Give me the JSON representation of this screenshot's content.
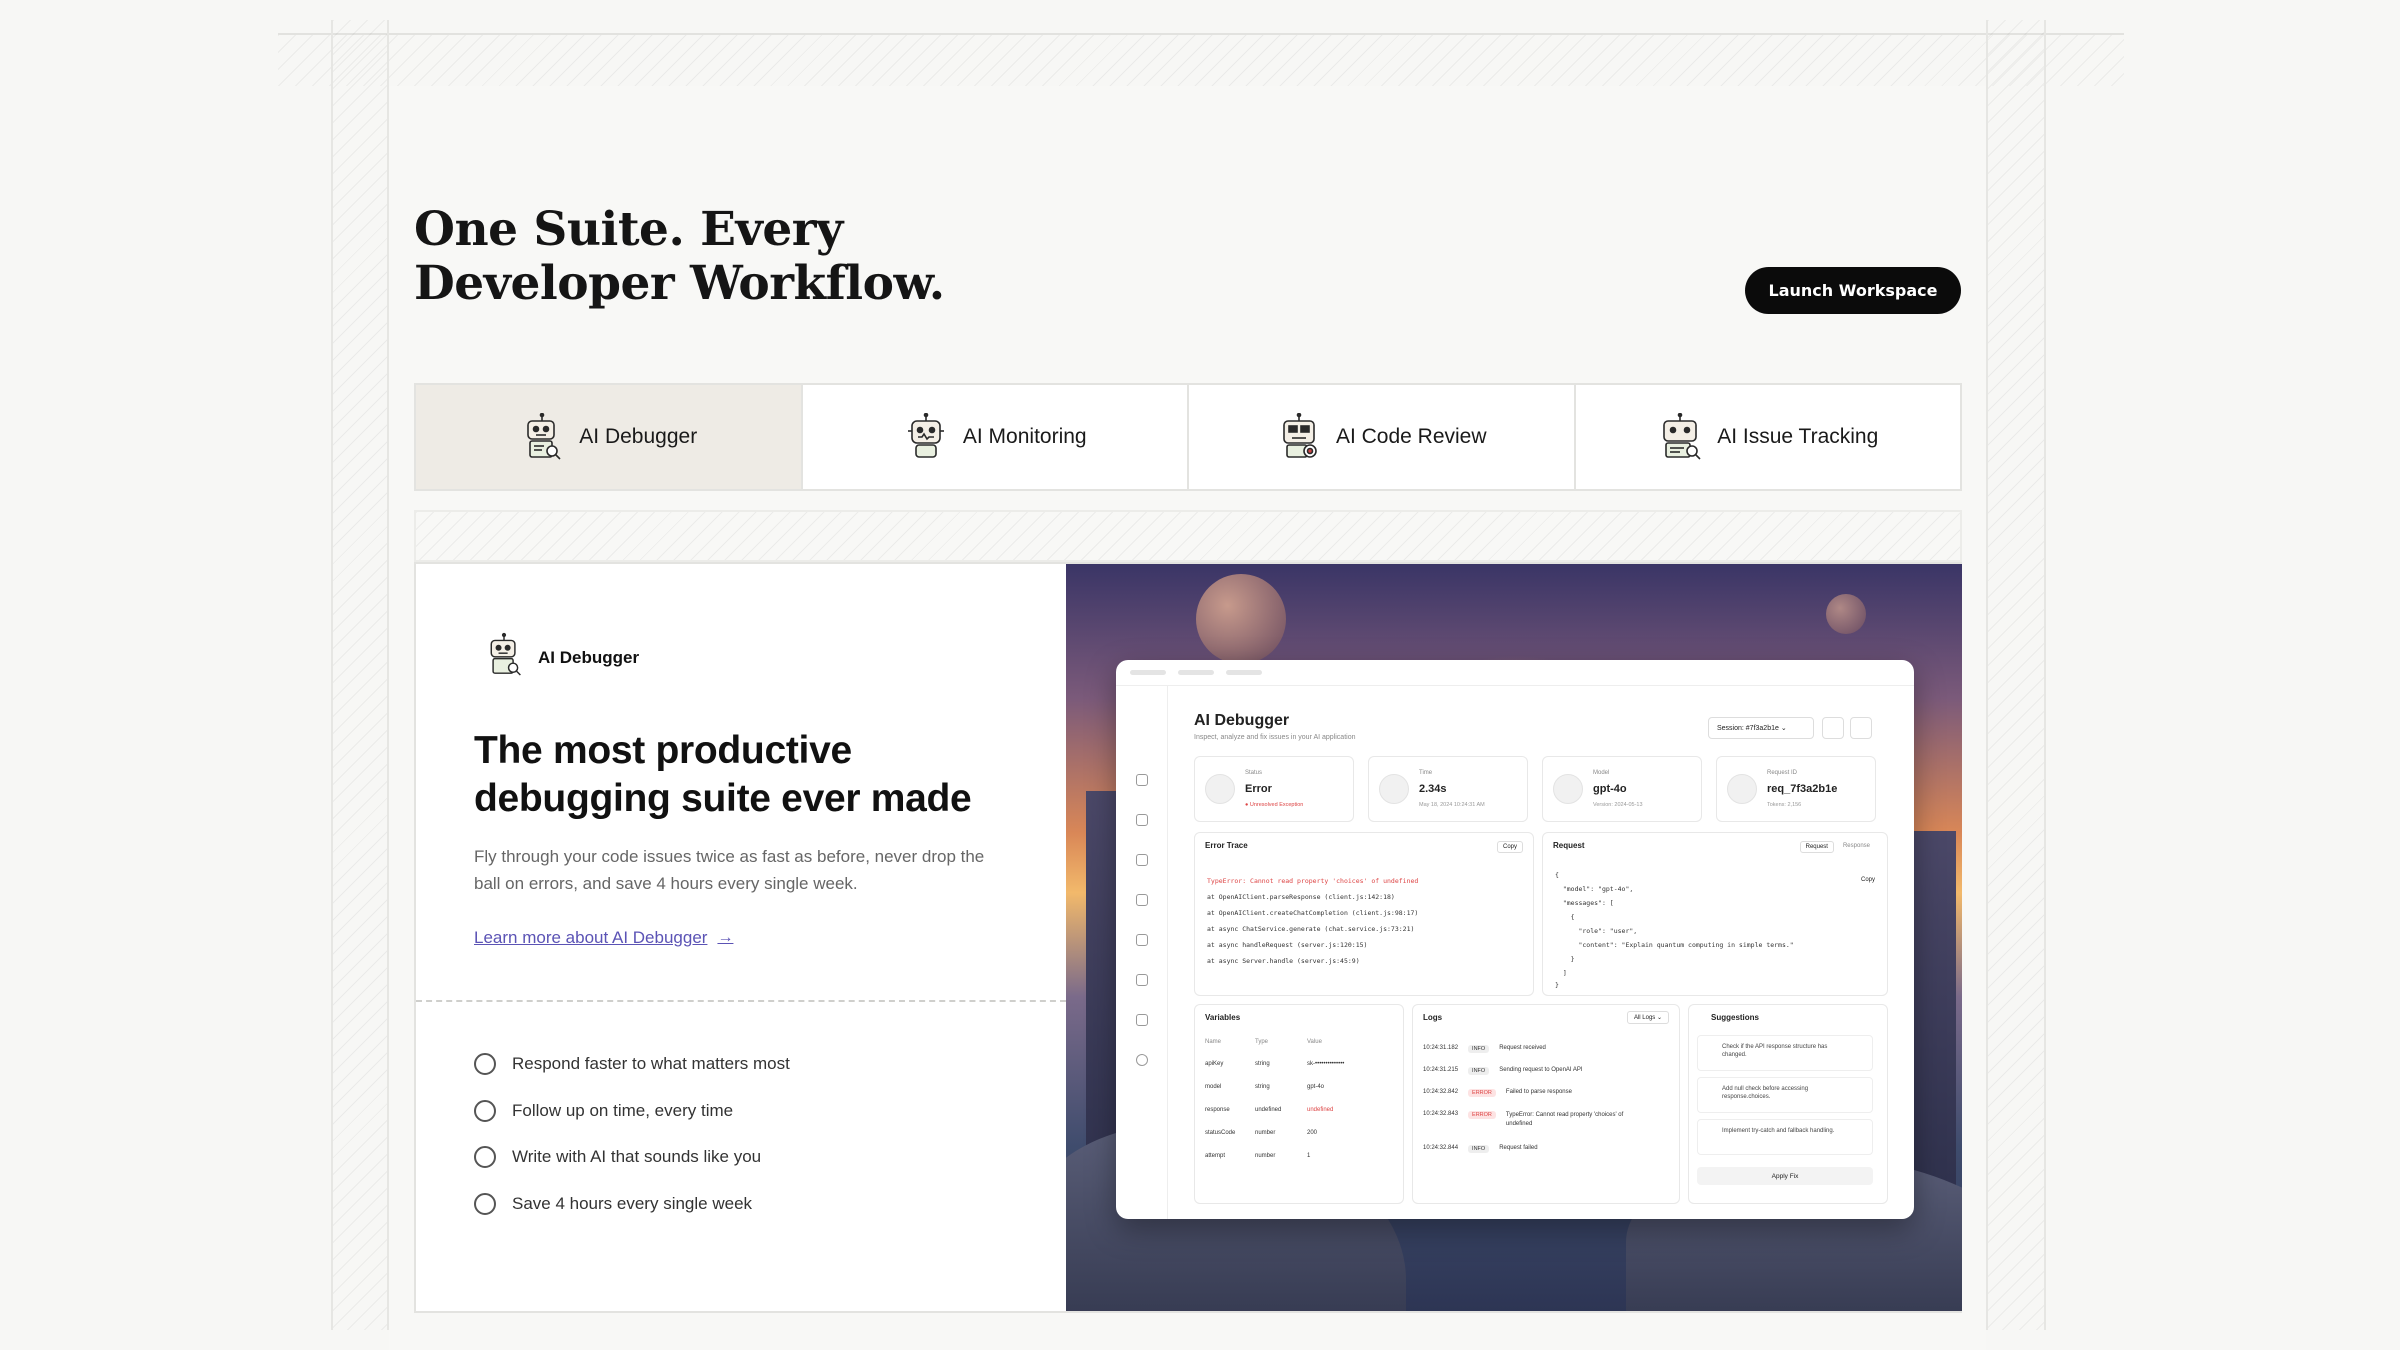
{
  "hero": {
    "headline_line1": "One Suite. Every",
    "headline_line2": "Developer Workflow.",
    "launch_label": "Launch Workspace"
  },
  "tabs": [
    {
      "label": "AI Debugger",
      "active": true,
      "icon": "robot-debugger-icon"
    },
    {
      "label": "AI Monitoring",
      "active": false,
      "icon": "robot-monitoring-icon"
    },
    {
      "label": "AI Code Review",
      "active": false,
      "icon": "robot-code-review-icon"
    },
    {
      "label": "AI Issue Tracking",
      "active": false,
      "icon": "robot-issue-tracking-icon"
    }
  ],
  "feature": {
    "brand": "AI Debugger",
    "title": "The most productive debugging suite ever made",
    "description": "Fly through your code issues twice as fast as before, never drop the ball on errors, and save 4 hours every single week.",
    "link_label": "Learn more about AI Debugger",
    "bullets": [
      "Respond faster to what matters most",
      "Follow up on time, every time",
      "Write with AI that sounds like you",
      "Save 4 hours every single week"
    ]
  },
  "mockup": {
    "title": "AI Debugger",
    "subtitle": "Inspect, analyze and fix issues in your AI application",
    "session": "Session: #7f3a2b1e",
    "stats": [
      {
        "label": "Status",
        "value": "Error",
        "sub": "● Unresolved Exception"
      },
      {
        "label": "Time",
        "value": "2.34s",
        "sub": "May 18, 2024 10:24:31 AM"
      },
      {
        "label": "Model",
        "value": "gpt-4o",
        "sub": "Version: 2024-05-13"
      },
      {
        "label": "Request ID",
        "value": "req_7f3a2b1e",
        "sub": "Tokens: 2,156"
      }
    ],
    "error_trace": {
      "title": "Error Trace",
      "copy": "Copy",
      "lines": [
        "TypeError: Cannot read property 'choices' of undefined",
        "at OpenAIClient.parseResponse (client.js:142:18)",
        "at OpenAIClient.createChatCompletion (client.js:98:17)",
        "at async ChatService.generate (chat.service.js:73:21)",
        "at async handleRequest (server.js:120:15)",
        "at async Server.handle (server.js:45:9)"
      ]
    },
    "request": {
      "title": "Request",
      "tab_request": "Request",
      "tab_response": "Response",
      "copy": "Copy",
      "lines": [
        "{",
        "  \"model\": \"gpt-4o\",",
        "  \"messages\": [",
        "    {",
        "      \"role\": \"user\",",
        "      \"content\": \"Explain quantum computing in simple terms.\"",
        "    }",
        "  ]",
        "}"
      ]
    },
    "variables": {
      "title": "Variables",
      "headers": [
        "Name",
        "Type",
        "Value"
      ],
      "rows": [
        [
          "apiKey",
          "string",
          "sk-••••••••••••••"
        ],
        [
          "model",
          "string",
          "gpt-4o"
        ],
        [
          "response",
          "undefined",
          "undefined"
        ],
        [
          "statusCode",
          "number",
          "200"
        ],
        [
          "attempt",
          "number",
          "1"
        ]
      ]
    },
    "logs": {
      "title": "Logs",
      "filter": "All Logs",
      "rows": [
        {
          "time": "10:24:31.182",
          "level": "INFO",
          "msg": "Request received"
        },
        {
          "time": "10:24:31.215",
          "level": "INFO",
          "msg": "Sending request to OpenAI API"
        },
        {
          "time": "10:24:32.842",
          "level": "ERROR",
          "msg": "Failed to parse response"
        },
        {
          "time": "10:24:32.843",
          "level": "ERROR",
          "msg": "TypeError: Cannot read property 'choices' of undefined"
        },
        {
          "time": "10:24:32.844",
          "level": "INFO",
          "msg": "Request failed"
        }
      ]
    },
    "suggestions": {
      "title": "Suggestions",
      "items": [
        "Check if the API response structure has changed.",
        "Add null check before accessing response.choices.",
        "Implement try-catch and fallback handling."
      ],
      "apply_label": "Apply Fix"
    }
  },
  "colors": {
    "accent_link": "#5b53b5",
    "button_bg": "#0b0b0b",
    "active_tab_bg": "#eeebe5",
    "error_red": "#dd4444"
  }
}
